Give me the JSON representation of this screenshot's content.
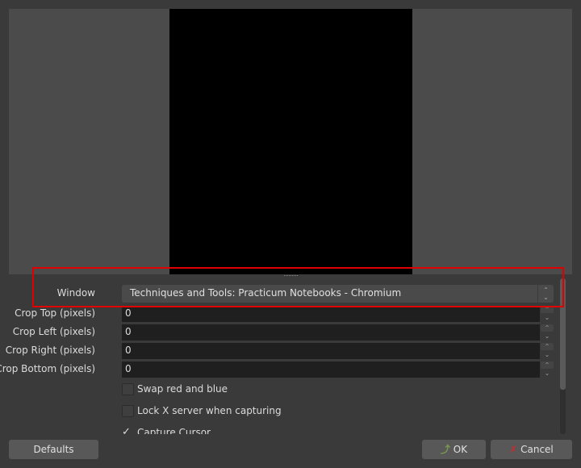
{
  "form": {
    "window_label": "Window",
    "window_value": "Techniques and Tools: Practicum Notebooks - Chromium",
    "crop_top_label": "Crop Top (pixels)",
    "crop_top_value": "0",
    "crop_left_label": "Crop Left (pixels)",
    "crop_left_value": "0",
    "crop_right_label": "Crop Right (pixels)",
    "crop_right_value": "0",
    "crop_bottom_label": "Crop Bottom (pixels)",
    "crop_bottom_value": "0",
    "swap_label": "Swap red and blue",
    "swap_checked": false,
    "lock_label": "Lock X server when capturing",
    "lock_checked": false,
    "cursor_label": "Capture Cursor",
    "cursor_checked": true
  },
  "buttons": {
    "defaults": "Defaults",
    "ok": "OK",
    "cancel": "Cancel"
  },
  "colors": {
    "highlight": "#e00000"
  }
}
